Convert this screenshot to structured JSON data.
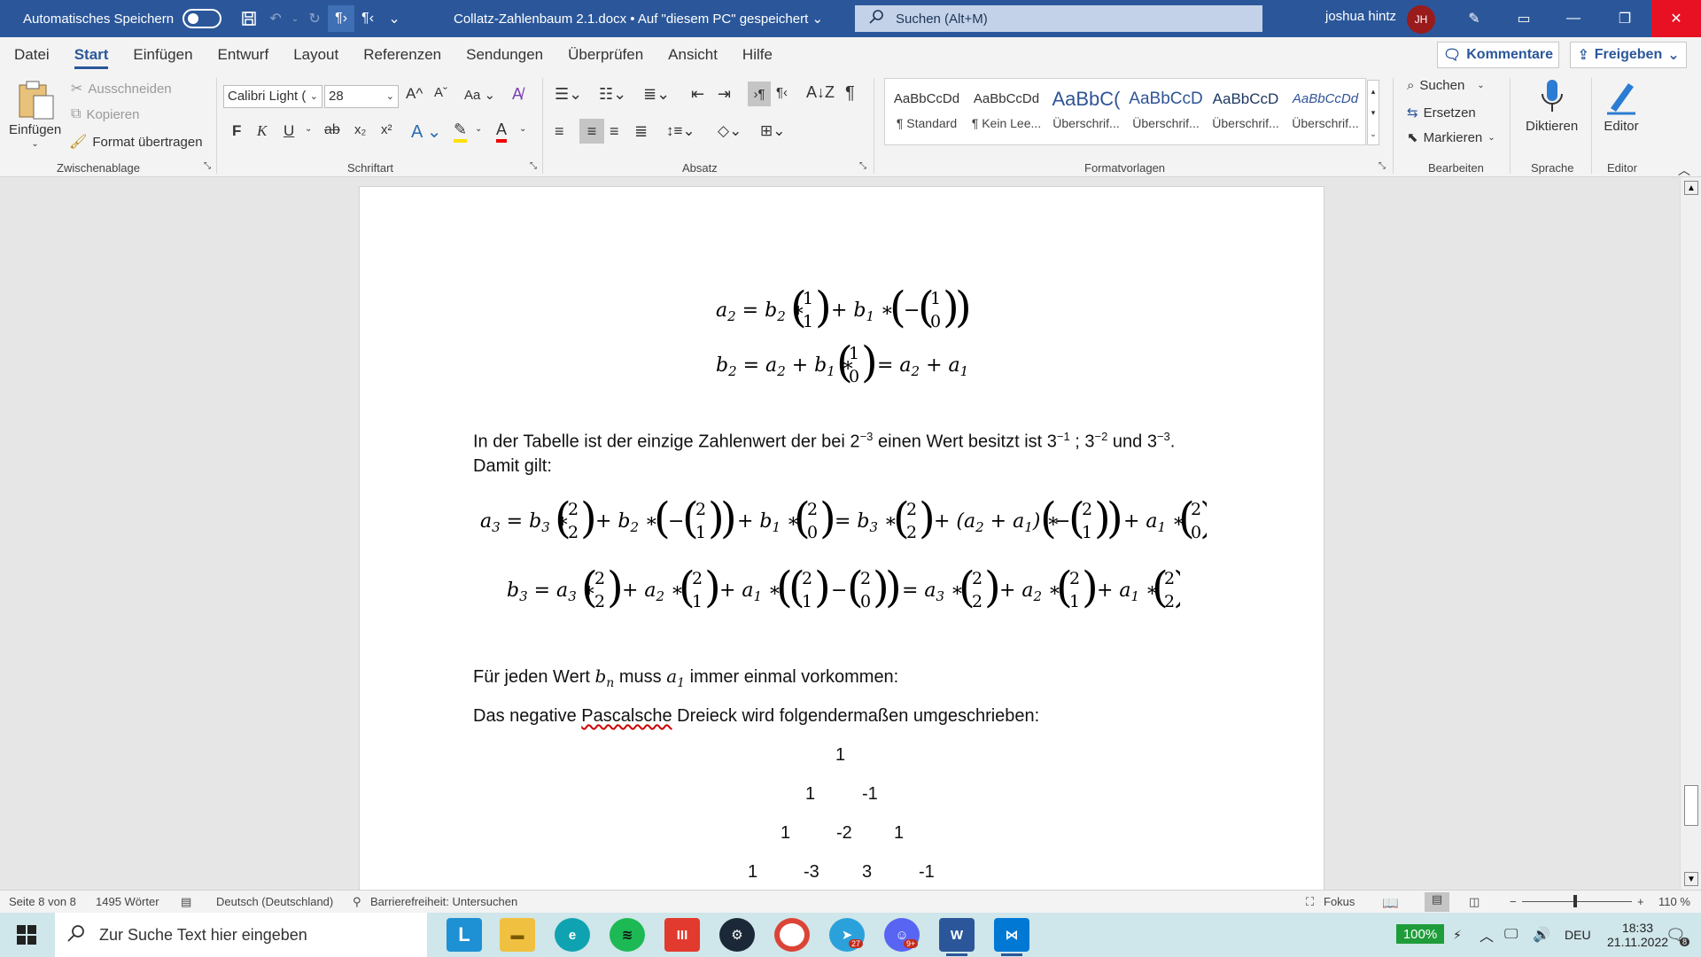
{
  "titlebar": {
    "autosave_label": "Automatisches Speichern",
    "doc_title": "Collatz-Zahlenbaum 2.1.docx • Auf \"diesem PC\" gespeichert",
    "search_placeholder": "Suchen (Alt+M)",
    "user_name": "joshua hintz",
    "user_initials": "JH"
  },
  "tabs": [
    "Datei",
    "Start",
    "Einfügen",
    "Entwurf",
    "Layout",
    "Referenzen",
    "Sendungen",
    "Überprüfen",
    "Ansicht",
    "Hilfe"
  ],
  "actions": {
    "comments": "Kommentare",
    "share": "Freigeben"
  },
  "ribbon": {
    "clipboard": {
      "paste": "Einfügen",
      "cut": "Ausschneiden",
      "copy": "Kopieren",
      "format_painter": "Format übertragen",
      "label": "Zwischenablage"
    },
    "font": {
      "family": "Calibri Light (",
      "size": "28",
      "label": "Schriftart"
    },
    "paragraph": {
      "label": "Absatz"
    },
    "styles": {
      "label": "Formatvorlagen",
      "items": [
        {
          "preview": "AaBbCcDd",
          "name": "¶ Standard"
        },
        {
          "preview": "AaBbCcDd",
          "name": "¶ Kein Lee..."
        },
        {
          "preview": "AaBbC(",
          "name": "Überschrif..."
        },
        {
          "preview": "AaBbCcD",
          "name": "Überschrif..."
        },
        {
          "preview": "AaBbCcD",
          "name": "Überschrif..."
        },
        {
          "preview": "AaBbCcDd",
          "name": "Überschrif..."
        }
      ]
    },
    "editing": {
      "find": "Suchen",
      "replace": "Ersetzen",
      "select": "Markieren",
      "label": "Bearbeiten"
    },
    "voice": {
      "dictate": "Diktieren",
      "label": "Sprache"
    },
    "editor": {
      "name": "Editor",
      "label": "Editor"
    }
  },
  "document": {
    "paragraph1_a": "In der Tabelle ist der einzige Zahlenwert der bei 2",
    "paragraph1_b": " einen Wert besitzt ist 3",
    "paragraph1_c": " ; 3",
    "paragraph1_d": " und 3",
    "paragraph1_e": ".",
    "exp_m3": "−3",
    "exp_m1": "−1",
    "exp_m2": "−2",
    "paragraph2": "Damit gilt:",
    "paragraph3_a": "Für jeden Wert ",
    "paragraph3_b": " muss ",
    "paragraph3_c": " immer einmal vorkommen:",
    "paragraph4_a": "Das negative ",
    "paragraph4_b": "Pascalsche",
    "paragraph4_c": " Dreieck wird folgendermaßen umgeschrieben:",
    "triangle": [
      [
        "1"
      ],
      [
        "1",
        "-1"
      ],
      [
        "1",
        "-2",
        "1"
      ],
      [
        "1",
        "-3",
        "3",
        "-1"
      ]
    ]
  },
  "statusbar": {
    "page": "Seite 8 von 8",
    "words": "1495 Wörter",
    "language": "Deutsch (Deutschland)",
    "accessibility": "Barrierefreiheit: Untersuchen",
    "focus": "Fokus",
    "zoom": "110 %"
  },
  "taskbar": {
    "search_placeholder": "Zur Suche Text hier eingeben",
    "battery": "100%",
    "lang": "DEU",
    "time": "18:33",
    "date": "21.11.2022",
    "telegram_badge": "27",
    "discord_badge": "9+",
    "notif_count": "8"
  }
}
